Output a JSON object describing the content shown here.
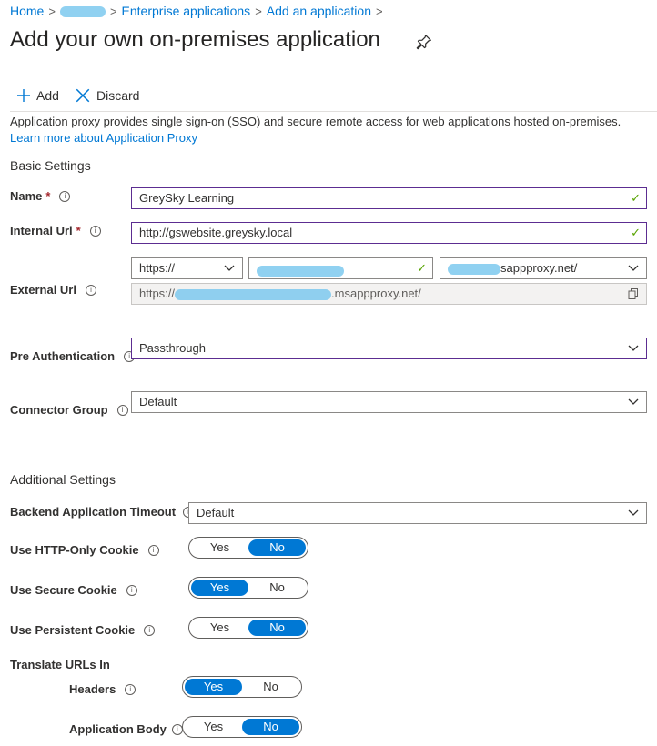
{
  "breadcrumb": {
    "home": "Home",
    "enterprise": "Enterprise applications",
    "add": "Add an application",
    "separator": ">"
  },
  "title": "Add your own on-premises application",
  "toolbar": {
    "add_label": "Add",
    "discard_label": "Discard"
  },
  "description": {
    "text": "Application proxy provides single sign-on (SSO) and secure remote access for web applications hosted on-premises. ",
    "link": "Learn more about Application Proxy"
  },
  "basic_settings": {
    "heading": "Basic Settings",
    "name_label": "Name",
    "name_value": "GreySky Learning",
    "internal_url_label": "Internal Url",
    "internal_url_value": "http://gswebsite.greysky.local",
    "external_url_label": "External Url",
    "external_scheme": "https://",
    "external_domain_suffix": "sappproxy.net/",
    "external_full_prefix": "https://",
    "external_full_suffix": ".msappproxy.net/",
    "pre_auth_label": "Pre Authentication",
    "pre_auth_value": "Passthrough",
    "connector_group_label": "Connector Group",
    "connector_group_value": "Default",
    "required_mark": "*"
  },
  "additional_settings": {
    "heading": "Additional Settings",
    "backend_timeout_label": "Backend Application Timeout",
    "backend_timeout_value": "Default",
    "http_only_label": "Use HTTP-Only Cookie",
    "http_only_value": "No",
    "secure_cookie_label": "Use Secure Cookie",
    "secure_cookie_value": "Yes",
    "persistent_cookie_label": "Use Persistent Cookie",
    "persistent_cookie_value": "No",
    "translate_heading": "Translate URLs In",
    "headers_label": "Headers",
    "headers_value": "Yes",
    "app_body_label": "Application Body",
    "app_body_value": "No",
    "yes": "Yes",
    "no": "No"
  },
  "colors": {
    "accent": "#0078d4",
    "focus_border": "#5c2d91",
    "valid_check": "#57a300",
    "required": "#a4262c",
    "redaction": "#7cc9ee"
  },
  "icons": {
    "add": "plus-icon",
    "discard": "x-icon",
    "pin": "pin-icon",
    "info": "info-icon",
    "check": "checkmark-icon",
    "dropdown": "chevron-down-icon",
    "copy": "copy-icon"
  }
}
